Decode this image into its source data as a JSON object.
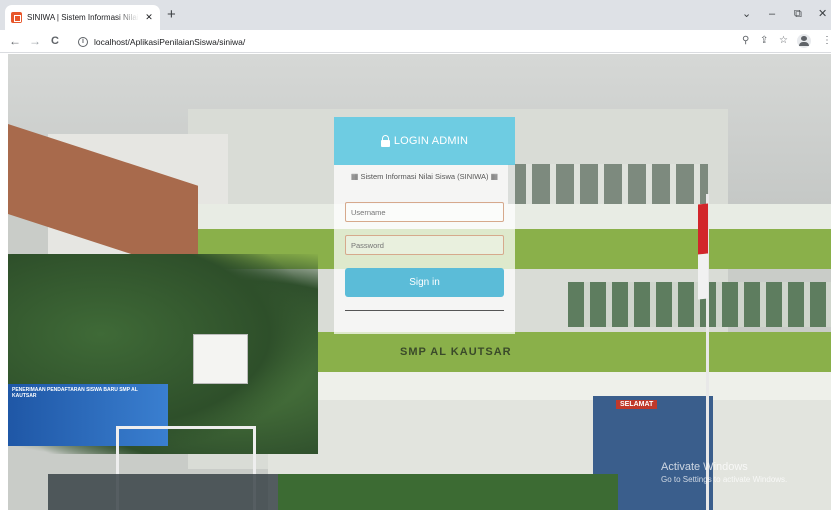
{
  "browser": {
    "tab_title": "SINIWA | Sistem Informasi Nilai Siswa",
    "tab_close": "✕",
    "new_tab": "+",
    "url": "localhost/AplikasiPenilaianSiswa/siniwa/",
    "nav": {
      "back": "←",
      "forward": "→",
      "reload": "C",
      "info": "i"
    },
    "tools": {
      "zoom": "⚲",
      "share": "⇪",
      "bookmark": "☆",
      "menu": "⋮"
    },
    "window_controls": {
      "dropdown": "⌄",
      "minimize": "–",
      "restore": "⧉",
      "close": "✕"
    }
  },
  "login": {
    "title": "LOGIN ADMIN",
    "subtitle": "Sistem Informasi Nilai Siswa (SINIWA)",
    "subtitle_icon": "▦",
    "username_placeholder": "Username",
    "password_placeholder": "Password",
    "signin_label": "Sign in",
    "accent_color": "#56c4de"
  },
  "background": {
    "school_sign": "SMP AL KAUTSAR",
    "banner_text": "PENERIMAAN PENDAFTARAN SISWA BARU SMP AL KAUTSAR",
    "shop_sign": "SELAMAT"
  },
  "watermark": {
    "title": "Activate Windows",
    "subtitle": "Go to Settings to activate Windows."
  }
}
